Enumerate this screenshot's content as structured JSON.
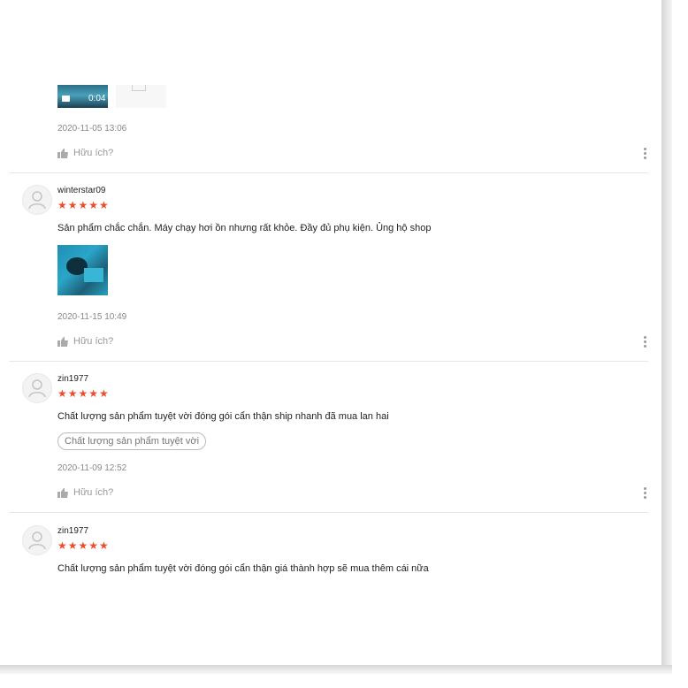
{
  "colors": {
    "star": "#ee4d2d",
    "muted": "#888888"
  },
  "reviews": [
    {
      "media": [
        {
          "type": "video",
          "duration": "0:04",
          "icon": "video-camera-icon"
        },
        {
          "type": "image"
        }
      ],
      "date": "2020-11-05 13:06",
      "helpful_label": "Hữu ích?"
    },
    {
      "username": "winterstar09",
      "stars": "★★★★★",
      "comment": "Sản phẩm chắc chắn. Máy chạy hơi ồn nhưng rất khỏe.  Đầy đủ phụ kiện. Ủng hộ shop",
      "media": [
        {
          "type": "image"
        }
      ],
      "date": "2020-11-15 10:49",
      "helpful_label": "Hữu ích?"
    },
    {
      "username": "zin1977",
      "stars": "★★★★★",
      "comment": "Chất lượng sản phẩm tuyệt vời đóng gói cẩn thận ship nhanh đã mua lan hai",
      "tag": "Chất lượng sản phẩm tuyệt vời",
      "date": "2020-11-09 12:52",
      "helpful_label": "Hữu ích?"
    },
    {
      "username": "zin1977",
      "stars": "★★★★★",
      "comment": "Chất lượng sản phẩm tuyệt vời đóng gói cẩn thận giá thành hợp sẽ mua thêm cái nữa"
    }
  ]
}
